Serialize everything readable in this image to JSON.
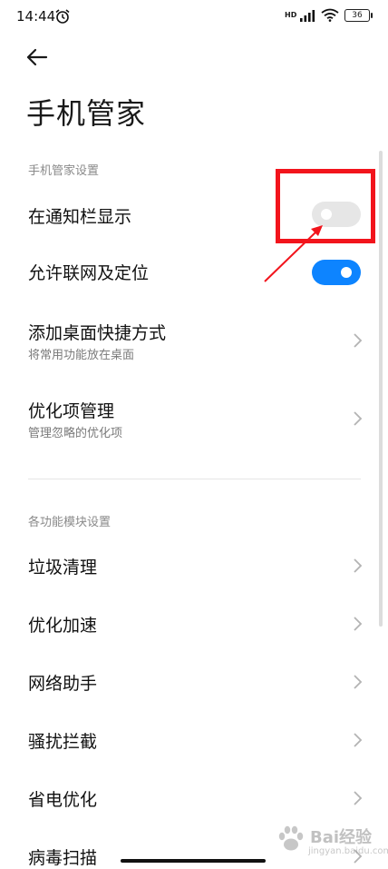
{
  "status_bar": {
    "time": "14:44",
    "network_label": "HD",
    "battery": "36"
  },
  "page": {
    "title": "手机管家"
  },
  "sections": [
    {
      "label": "手机管家设置",
      "items": [
        {
          "title": "在通知栏显示",
          "control": "toggle",
          "on": false
        },
        {
          "title": "允许联网及定位",
          "control": "toggle",
          "on": true
        },
        {
          "title": "添加桌面快捷方式",
          "subtitle": "将常用功能放在桌面",
          "control": "chevron"
        },
        {
          "title": "优化项管理",
          "subtitle": "管理忽略的优化项",
          "control": "chevron"
        }
      ]
    },
    {
      "label": "各功能模块设置",
      "items": [
        {
          "title": "垃圾清理",
          "control": "chevron"
        },
        {
          "title": "优化加速",
          "control": "chevron"
        },
        {
          "title": "网络助手",
          "control": "chevron"
        },
        {
          "title": "骚扰拦截",
          "control": "chevron"
        },
        {
          "title": "省电优化",
          "control": "chevron"
        },
        {
          "title": "病毒扫描",
          "control": "chevron"
        }
      ]
    }
  ],
  "watermark": {
    "text": "Bai经验",
    "sub": "jingyan.baidu.com"
  },
  "colors": {
    "accent": "#0d84ff",
    "highlight": "#f2141c",
    "toggle_off": "#e6e6e6"
  }
}
